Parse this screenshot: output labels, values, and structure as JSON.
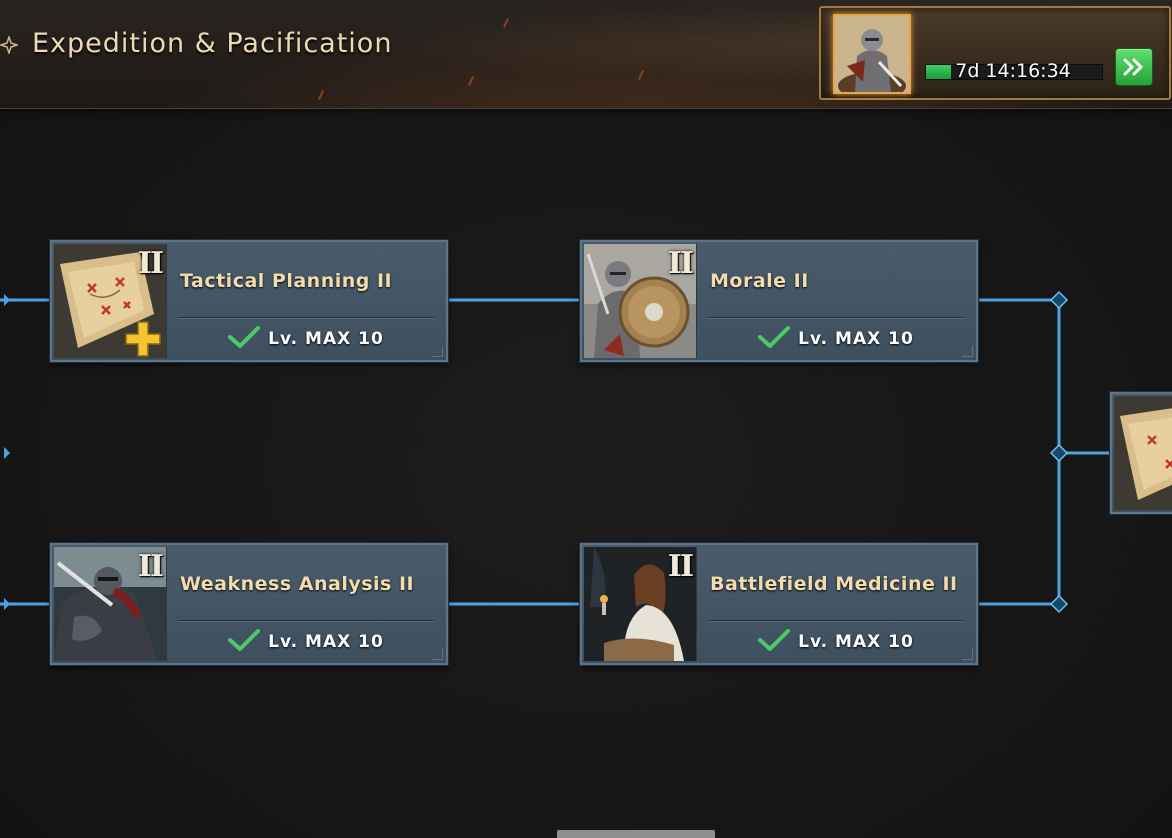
{
  "header": {
    "title": "Expedition & Pacification",
    "event": {
      "timer": "7d 14:16:34",
      "progress": 0.14
    }
  },
  "skills": [
    {
      "name": "Tactical Planning II",
      "tier": "II",
      "level": "Lv. MAX 10",
      "icon": "tactical-map-icon"
    },
    {
      "name": "Morale II",
      "tier": "II",
      "level": "Lv. MAX 10",
      "icon": "knight-shield-icon"
    },
    {
      "name": "Weakness Analysis II",
      "tier": "II",
      "level": "Lv. MAX 10",
      "icon": "armored-warrior-icon"
    },
    {
      "name": "Battlefield Medicine II",
      "tier": "II",
      "level": "Lv. MAX 10",
      "icon": "healer-icon"
    }
  ],
  "colors": {
    "connector": "#4aa3e0",
    "title": "#efd9b2",
    "skill_name": "#f2dcae",
    "check": "#4ec96a",
    "card": "#42535f"
  }
}
